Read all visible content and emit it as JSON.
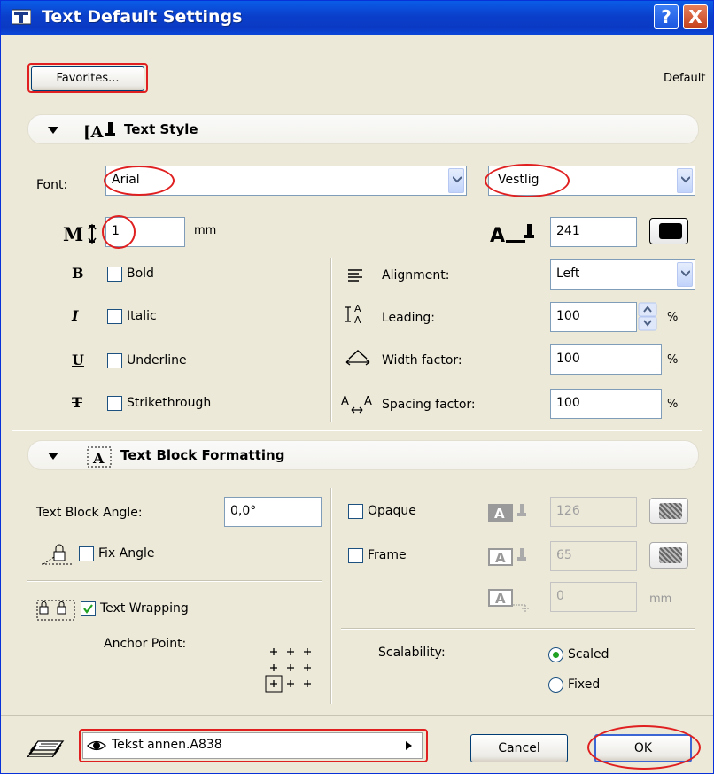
{
  "window": {
    "title": "Text Default Settings",
    "help": "?",
    "close": "X"
  },
  "toolbar": {
    "favorites": "Favorites...",
    "default": "Default"
  },
  "text_style": {
    "section_title": "Text Style",
    "font_label": "Font:",
    "font_value": "Arial",
    "charset_value": "Vestlig",
    "size_value": "1",
    "size_unit": "mm",
    "pen_value": "241",
    "bold": {
      "label": "Bold",
      "checked": false
    },
    "italic": {
      "label": "Italic",
      "checked": false
    },
    "underline": {
      "label": "Underline",
      "checked": false
    },
    "strike": {
      "label": "Strikethrough",
      "checked": false
    },
    "alignment": {
      "label": "Alignment:",
      "value": "Left"
    },
    "leading": {
      "label": "Leading:",
      "value": "100",
      "unit": "%"
    },
    "width_factor": {
      "label": "Width factor:",
      "value": "100",
      "unit": "%"
    },
    "spacing_factor": {
      "label": "Spacing factor:",
      "value": "100",
      "unit": "%"
    }
  },
  "block": {
    "section_title": "Text Block Formatting",
    "angle_label": "Text Block Angle:",
    "angle_value": "0,0°",
    "fix_angle": {
      "label": "Fix Angle",
      "checked": false
    },
    "wrapping": {
      "label": "Text Wrapping",
      "checked": true
    },
    "anchor_label": "Anchor Point:",
    "opaque": {
      "label": "Opaque",
      "checked": false,
      "pen": "126"
    },
    "frame": {
      "label": "Frame",
      "checked": false,
      "pen": "65"
    },
    "offset": {
      "value": "0",
      "unit": "mm"
    },
    "scalability_label": "Scalability:",
    "scaled": {
      "label": "Scaled",
      "selected": true
    },
    "fixed": {
      "label": "Fixed",
      "selected": false
    }
  },
  "footer": {
    "layer": "Tekst annen.A838",
    "cancel": "Cancel",
    "ok": "OK"
  },
  "colors": {
    "titlebar": "#0a3fcb",
    "dialog_bg": "#ece9d8",
    "highlight": "#e02020",
    "check_green": "#21a121"
  }
}
